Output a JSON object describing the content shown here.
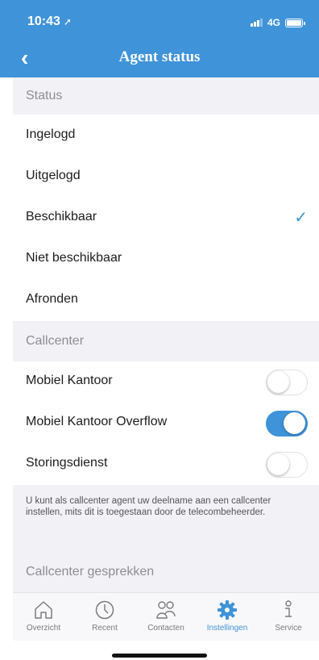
{
  "statusbar": {
    "time": "10:43",
    "network": "4G"
  },
  "header": {
    "back_icon": "chevron-left-icon",
    "title": "Agent status"
  },
  "status_section": {
    "label": "Status",
    "items": [
      {
        "label": "Ingelogd",
        "checked": false
      },
      {
        "label": "Uitgelogd",
        "checked": false
      },
      {
        "label": "Beschikbaar",
        "checked": true
      },
      {
        "label": "Niet beschikbaar",
        "checked": false
      },
      {
        "label": "Afronden",
        "checked": false
      }
    ]
  },
  "callcenter_section": {
    "label": "Callcenter",
    "items": [
      {
        "label": "Mobiel Kantoor",
        "on": false
      },
      {
        "label": "Mobiel Kantoor Overflow",
        "on": true
      },
      {
        "label": "Storingsdienst",
        "on": false
      }
    ],
    "info": "U kunt als callcenter agent uw deelname aan een callcenter instellen, mits dit is toegestaan door de telecombeheerder."
  },
  "gesprekken_section": {
    "label": "Callcenter gesprekken"
  },
  "tabbar": {
    "tabs": [
      {
        "label": "Overzicht",
        "icon": "home-icon",
        "active": false
      },
      {
        "label": "Recent",
        "icon": "clock-icon",
        "active": false
      },
      {
        "label": "Contacten",
        "icon": "contacts-icon",
        "active": false
      },
      {
        "label": "Instellingen",
        "icon": "gear-icon",
        "active": true
      },
      {
        "label": "Service",
        "icon": "info-icon",
        "active": false
      }
    ]
  },
  "colors": {
    "accent": "#3f93d9",
    "section_bg": "#f2f1f6"
  }
}
